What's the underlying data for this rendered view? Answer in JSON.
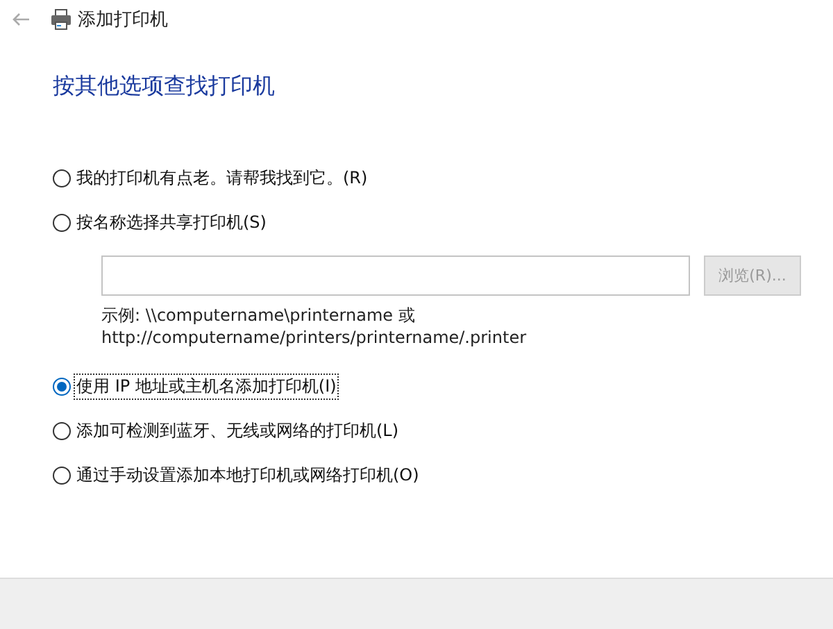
{
  "window": {
    "title": "添加打印机"
  },
  "heading": "按其他选项查找打印机",
  "options": [
    {
      "label": "我的打印机有点老。请帮我找到它。(R)",
      "selected": false
    },
    {
      "label": "按名称选择共享打印机(S)",
      "selected": false,
      "shared": {
        "browse_button": {
          "label": "浏览(R)...",
          "disabled": true
        },
        "example_lines": [
          "示例: \\\\computername\\printername 或",
          "http://computername/printers/printername/.printer"
        ]
      }
    },
    {
      "label": "使用 IP 地址或主机名添加打印机(I)",
      "selected": true
    },
    {
      "label": "添加可检测到蓝牙、无线或网络的打印机(L)",
      "selected": false
    },
    {
      "label": "通过手动设置添加本地打印机或网络打印机(O)",
      "selected": false
    }
  ]
}
